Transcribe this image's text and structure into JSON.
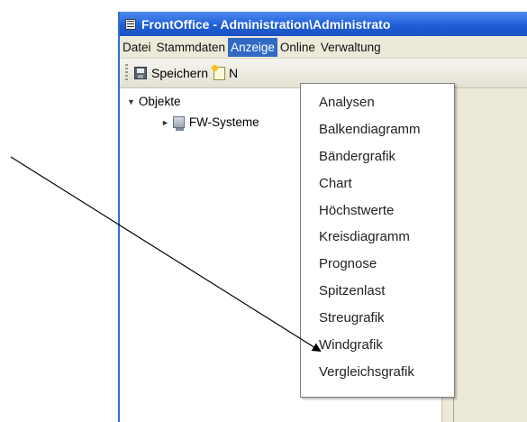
{
  "window": {
    "title": "FrontOffice - Administration\\Administrato"
  },
  "menubar": {
    "items": [
      {
        "label": "Datei"
      },
      {
        "label": "Stammdaten"
      },
      {
        "label": "Anzeige"
      },
      {
        "label": "Online"
      },
      {
        "label": "Verwaltung"
      }
    ]
  },
  "toolbar": {
    "save_label": "Speichern",
    "new_label_cut": "N"
  },
  "tree": {
    "root_label": "Objekte",
    "child_label": "FW-Systeme"
  },
  "anzeige_menu": {
    "items": [
      {
        "label": "Analysen"
      },
      {
        "label": "Balkendiagramm"
      },
      {
        "label": "Bändergrafik"
      },
      {
        "label": "Chart"
      },
      {
        "label": "Höchstwerte"
      },
      {
        "label": "Kreisdiagramm"
      },
      {
        "label": "Prognose"
      },
      {
        "label": "Spitzenlast"
      },
      {
        "label": "Streugrafik"
      },
      {
        "label": "Windgrafik"
      },
      {
        "label": "Vergleichsgrafik"
      }
    ]
  },
  "colors": {
    "titlebar": "#1f5fd6",
    "menu_highlight": "#316ac5",
    "chrome": "#ece9d8"
  },
  "icons": {
    "app": "app-window-icon",
    "save": "save-disk-icon",
    "new": "new-document-icon",
    "tree_node": "computer-icon"
  }
}
